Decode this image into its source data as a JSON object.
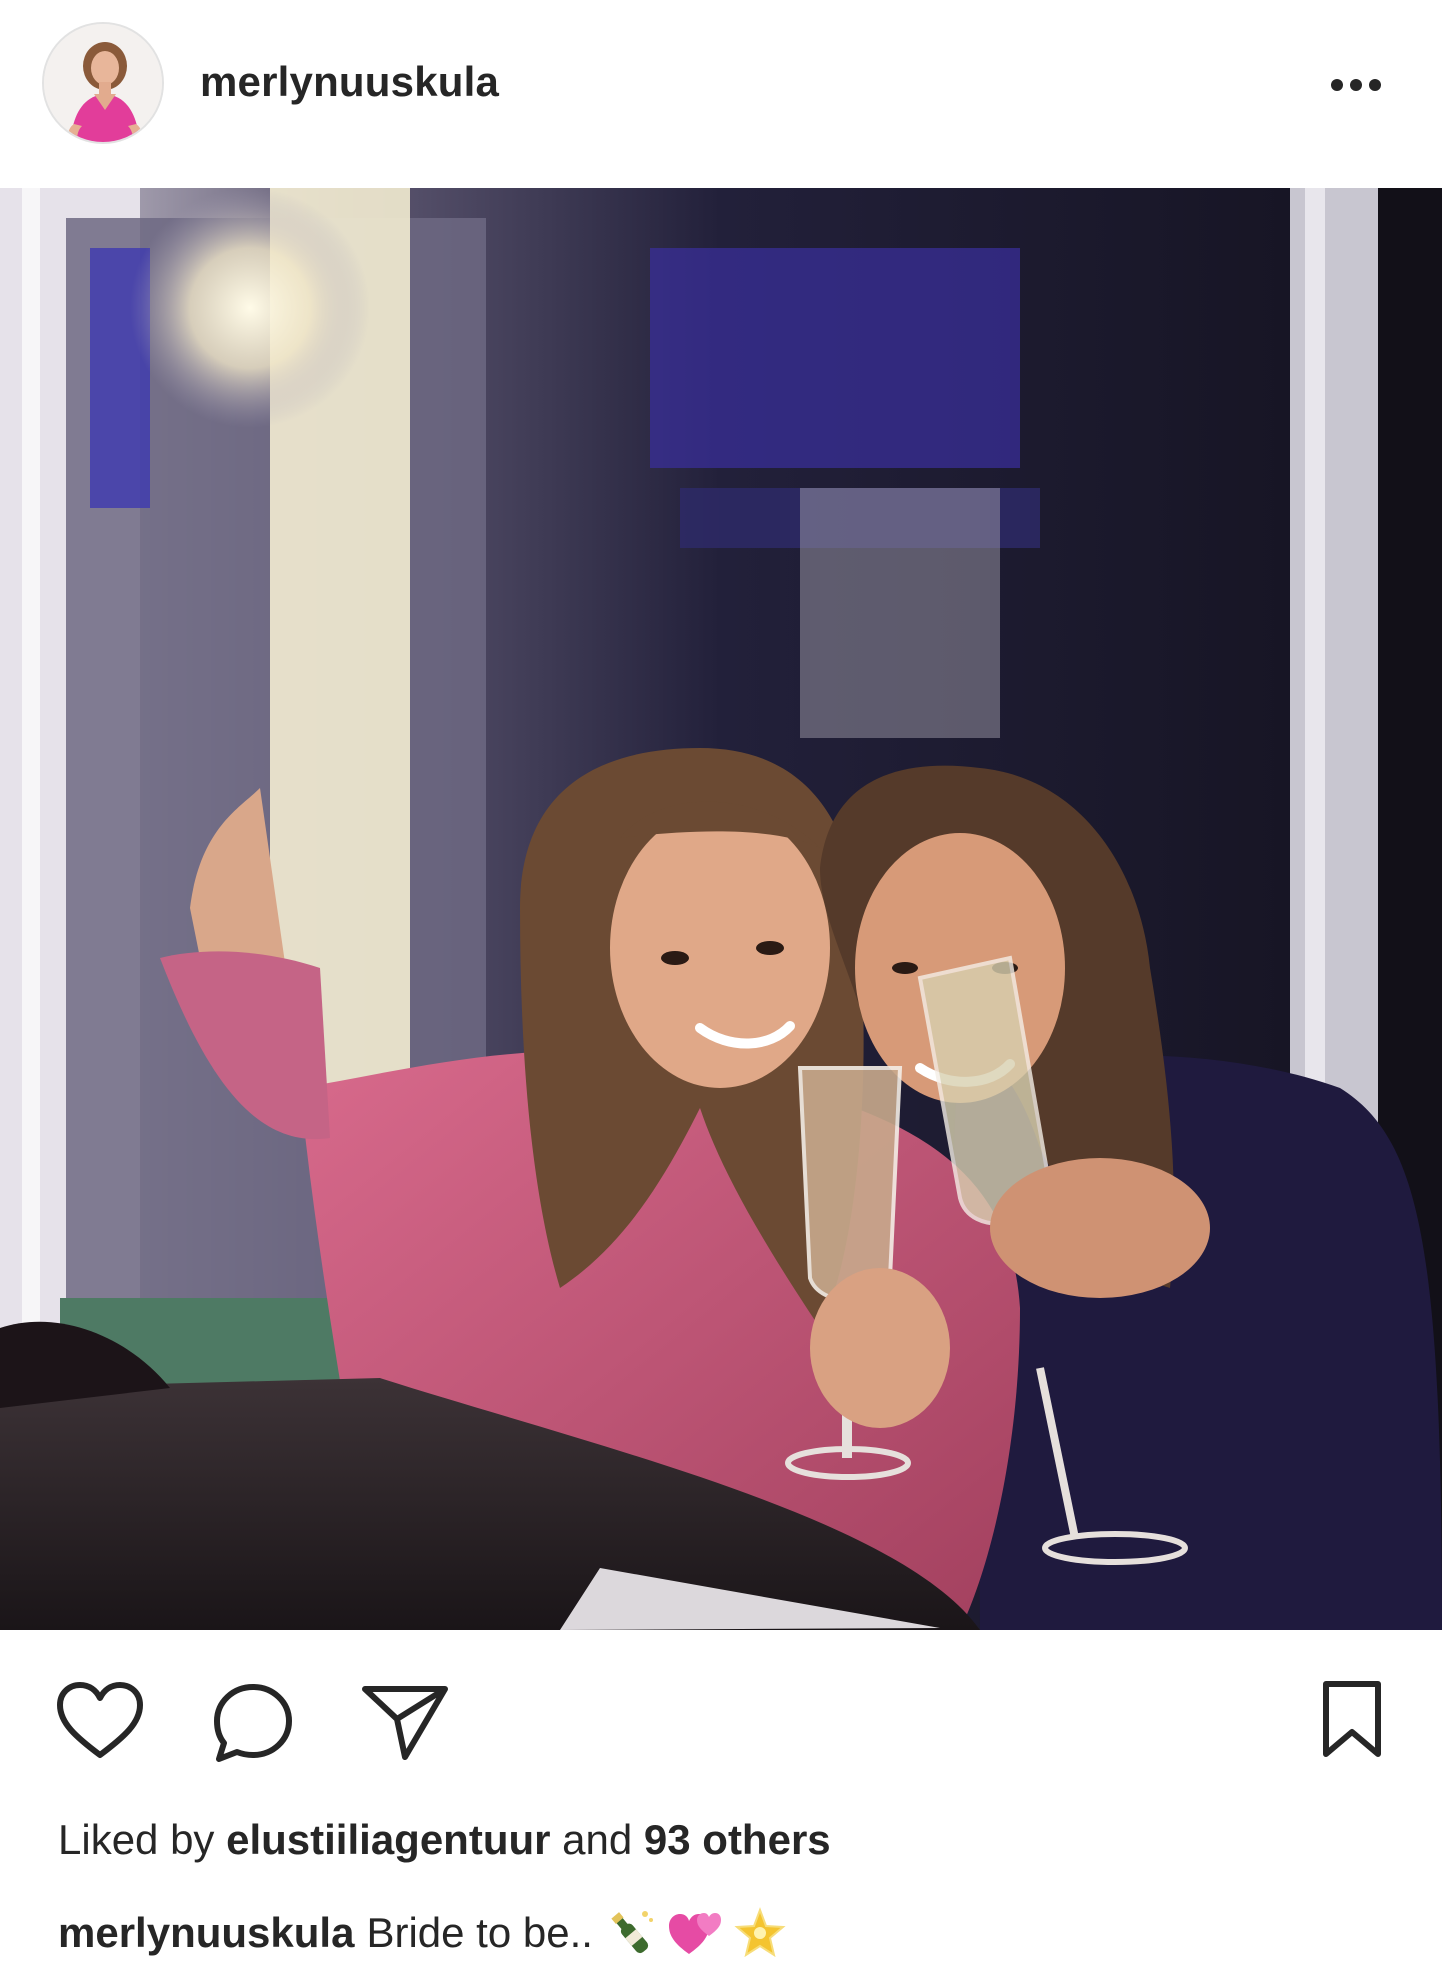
{
  "post": {
    "username": "merlynuuskula",
    "more_icon": "more-horizontal-icon"
  },
  "actions": {
    "like_icon": "heart-icon",
    "comment_icon": "comment-icon",
    "share_icon": "send-icon",
    "save_icon": "bookmark-icon"
  },
  "likes": {
    "prefix": "Liked by ",
    "user": "elustiiliagentuur",
    "middle": " and ",
    "count_text": "93 others"
  },
  "caption": {
    "username": "merlynuuskula",
    "text": "Bride to be..",
    "emojis": [
      "champagne-icon",
      "two-hearts-icon",
      "glowing-star-icon"
    ]
  },
  "colors": {
    "text": "#262626",
    "background": "#ffffff"
  }
}
